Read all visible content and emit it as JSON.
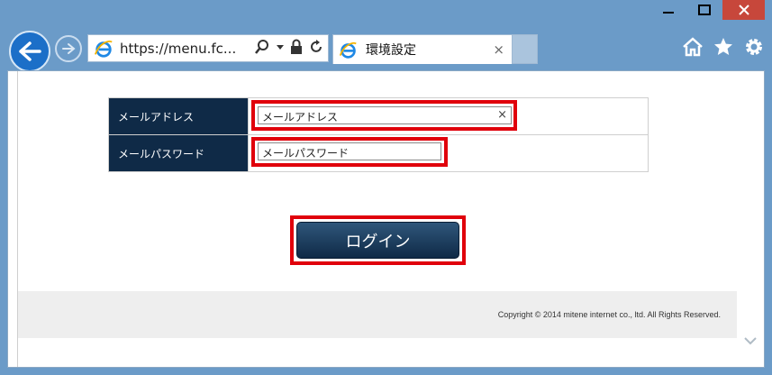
{
  "browser": {
    "address": "https://menu.fc...",
    "tab_title": "環境設定",
    "tab_close": "×",
    "window_controls": [
      "minimize-icon",
      "maximize-icon",
      "close-icon"
    ],
    "toolbar_icons": [
      "home-icon",
      "favorites-star-icon",
      "settings-gear-icon"
    ]
  },
  "form": {
    "email_label": "メールアドレス",
    "email_placeholder": "メールアドレス",
    "email_clear": "×",
    "password_label": "メールパスワード",
    "password_placeholder": "メールパスワード",
    "login_label": "ログイン"
  },
  "footer": {
    "copyright": "Copyright © 2014 mitene internet co., ltd. All Rights Reserved."
  },
  "colors": {
    "label_bg": "#0f2a47",
    "highlight": "#e0000b",
    "footer_bg": "#eeeeee"
  }
}
